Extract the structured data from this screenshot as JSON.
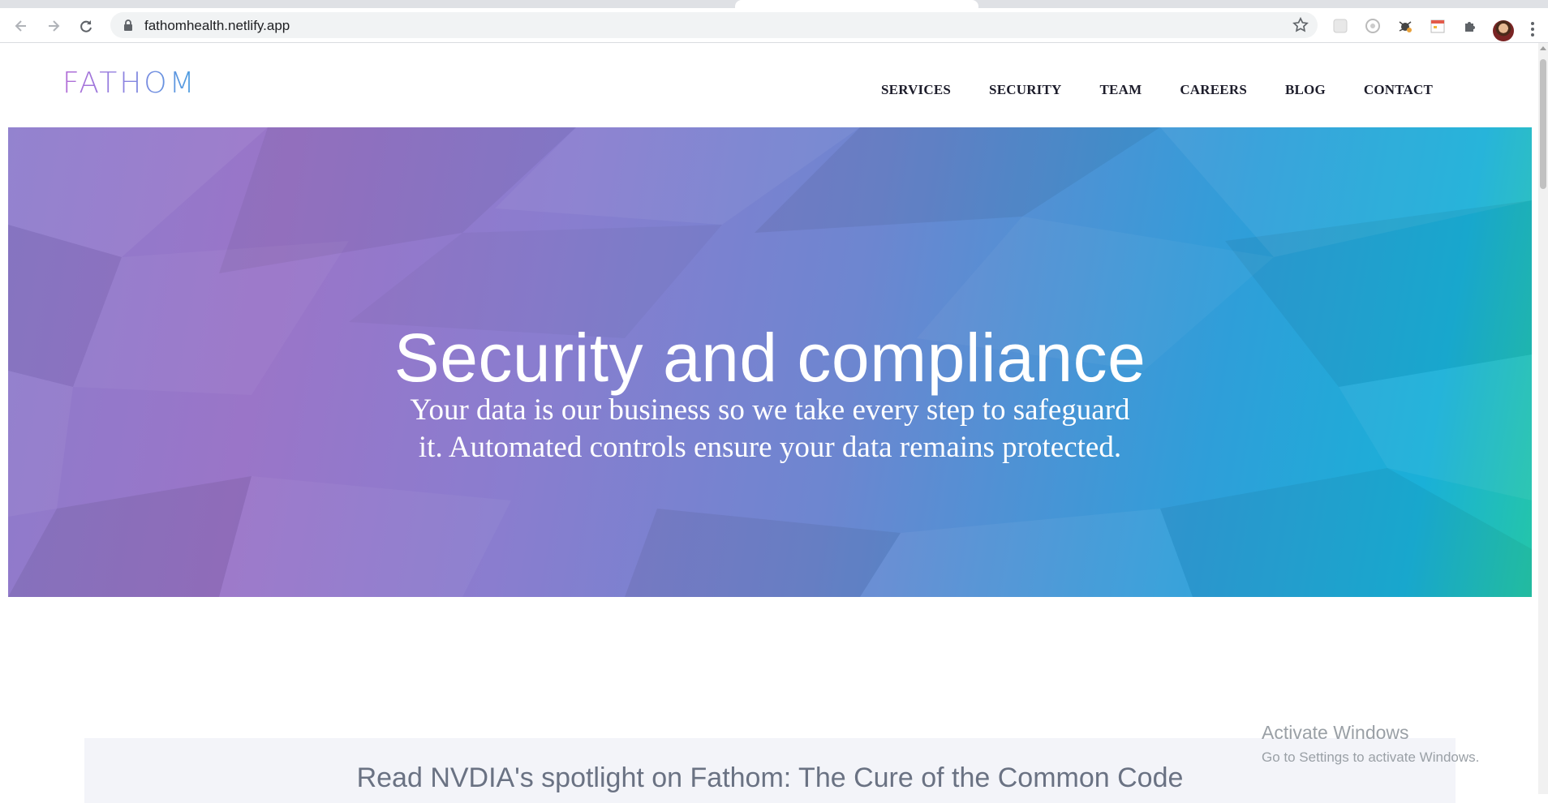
{
  "browser": {
    "url": "fathomhealth.netlify.app",
    "icons": [
      "back-arrow-icon",
      "forward-arrow-icon",
      "reload-icon",
      "lock-icon",
      "bookmark-star-icon",
      "extension-icon",
      "profile-avatar",
      "menu-icon"
    ]
  },
  "site": {
    "logo": "FATHOM",
    "nav": [
      "SERVICES",
      "SECURITY",
      "TEAM",
      "CAREERS",
      "BLOG",
      "CONTACT"
    ]
  },
  "hero": {
    "title": "Security and compliance",
    "subtitle_line1": "Your data is our business so we take every step to safeguard",
    "subtitle_line2": "it. Automated controls ensure your data remains protected."
  },
  "news": {
    "text": "Read NVDIA's spotlight on Fathom: The Cure of the Common Code"
  },
  "os_watermark": {
    "line1": "Activate Windows",
    "line2": "Go to Settings to activate Windows."
  },
  "colors": {
    "hero_start": "#9a75c8",
    "hero_end": "#1ab0d8",
    "nav_text": "#1d1d2b"
  }
}
